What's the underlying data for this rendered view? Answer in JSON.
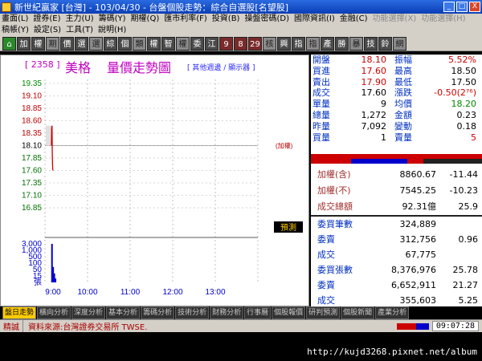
{
  "window": {
    "title": "新世紀贏家 [台灣] - 103/04/30 - 台盤個股走勢：綜合自選股[名望股]",
    "buttons": [
      "_",
      "□",
      "X"
    ]
  },
  "menu": {
    "row1": [
      "畫面(L)",
      "證券(E)",
      "主力(U)",
      "籌碼(Y)",
      "期權(Q)",
      "匯市利率(F)",
      "投資(B)",
      "操盤密碼(D)",
      "國際資訊(I)",
      "金融(C)",
      "功能選擇(X)",
      "功能選擇(H)"
    ],
    "row2": [
      "稿帳(Y)",
      "設定(S)",
      "工具(T)",
      "說明(H)"
    ]
  },
  "toolbar": [
    "加",
    "權",
    "期",
    "價",
    "選",
    "選",
    "綜",
    "個",
    "類",
    "權",
    "智",
    "權",
    "委",
    "江",
    "9",
    "8",
    "29",
    "核",
    "興",
    "指",
    "指",
    "產",
    "勝",
    "暴",
    "技",
    "鈴",
    "網"
  ],
  "header": {
    "code": "[ 2358 ]",
    "name": "美格",
    "title": "量價走勢圖",
    "link": "[ 其他週邊 / 顯示器 ]"
  },
  "chart_data": {
    "type": "line",
    "price_axis": [
      "19.35",
      "19.10",
      "18.85",
      "18.60",
      "18.35",
      "18.10",
      "17.85",
      "17.60",
      "17.35",
      "17.10",
      "16.85"
    ],
    "vol_axis": [
      "3,000",
      "1,000",
      "500",
      "100",
      "50",
      "15",
      "張"
    ],
    "time_axis": [
      "9:00",
      "10:00",
      "11:00",
      "12:00",
      "13:00"
    ],
    "ref_price": 18.1,
    "ref_label": "(加權)",
    "prediction_label": "預測",
    "price_series": [
      {
        "t": 0,
        "p": 18.1
      },
      {
        "t": 0.3,
        "p": 18.45
      },
      {
        "t": 0.6,
        "p": 18.5
      },
      {
        "t": 0.9,
        "p": 17.95
      },
      {
        "t": 1.2,
        "p": 17.7
      },
      {
        "t": 1.5,
        "p": 17.6
      }
    ],
    "volume_series": [
      {
        "t": 0.2,
        "v": 3000
      },
      {
        "t": 0.6,
        "v": 1200
      },
      {
        "t": 1.0,
        "v": 700
      },
      {
        "t": 1.4,
        "v": 300
      }
    ]
  },
  "quote": [
    {
      "l1": "開盤",
      "v1": "18.10",
      "l2": "振幅",
      "v2": "5.52%"
    },
    {
      "l1": "買進",
      "v1": "17.60",
      "l2": "最高",
      "v2": "18.50"
    },
    {
      "l1": "賣出",
      "v1": "17.90",
      "l2": "最低",
      "v2": "17.50"
    },
    {
      "l1": "成交",
      "v1": "17.60",
      "l2": "漲跌",
      "v2": "-0.50(2⁷⁶)"
    },
    {
      "l1": "單量",
      "v1": "9",
      "l2": "均價",
      "v2": "18.20"
    },
    {
      "l1": "總量",
      "v1": "1,272",
      "l2": "金額",
      "v2": "0.23"
    },
    {
      "l1": "昨量",
      "v1": "7,092",
      "l2": "變動",
      "v2": "0.18"
    },
    {
      "l1": "買量",
      "v1": "1",
      "l2": "賣量",
      "v2": "5"
    }
  ],
  "index": [
    {
      "label": "加權(含)",
      "v1": "8860.67",
      "v2": "-11.44"
    },
    {
      "label": "加權(不)",
      "v1": "7545.25",
      "v2": "-10.23"
    },
    {
      "label": "成交總額",
      "v1": "92.31億",
      "v2": "25.9"
    }
  ],
  "volume": [
    {
      "label": "委買筆數",
      "v1": "324,889",
      "v2": ""
    },
    {
      "label": "委賣",
      "v1": "312,756",
      "v2": "0.96"
    },
    {
      "label": "成交",
      "v1": "67,775",
      "v2": ""
    },
    {
      "label": "委買張數",
      "v1": "8,376,976",
      "v2": "25.78"
    },
    {
      "label": "委賣",
      "v1": "6,652,911",
      "v2": "21.27"
    },
    {
      "label": "成交",
      "v1": "355,603",
      "v2": "5.25"
    }
  ],
  "tabs": [
    "盤日走勢",
    "橫向分析",
    "深度分析",
    "基本分析",
    "籌碼分析",
    "技術分析",
    "財務分析",
    "行事曆",
    "個股報價",
    "研判預測",
    "個股新聞",
    "產業分析"
  ],
  "status": {
    "label": "精誠",
    "text": "資料來源:台灣證券交易所 TWSE.",
    "clock": "09:07:28"
  },
  "watermark": "http://kujd3268.pixnet.net/album",
  "colors": {
    "price_up": "#c00000",
    "price_line": "#c00000",
    "volume": "#0000cc",
    "label_blue": "#0030c0",
    "purple": "#c000c0"
  }
}
